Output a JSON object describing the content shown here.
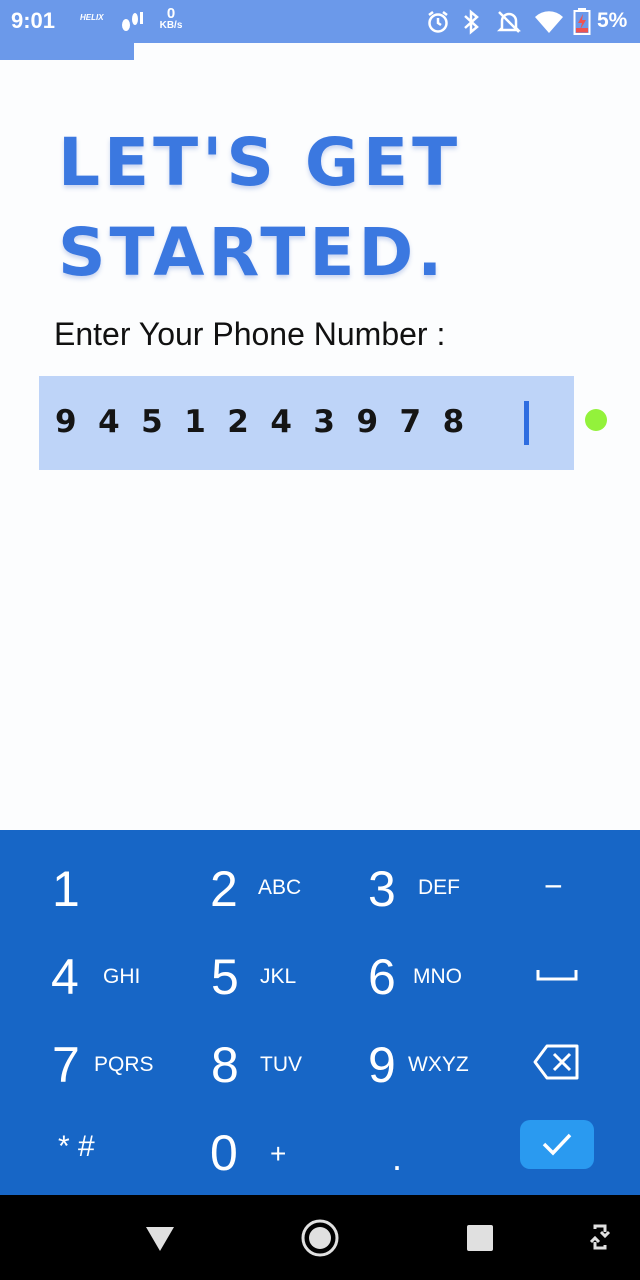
{
  "status_bar": {
    "time": "9:01",
    "carrier_logo": "HELIX",
    "network_speed_value": "0",
    "network_speed_unit": "KB/s",
    "battery_percent": "5%",
    "icons": [
      "notification-icon",
      "alarm-icon",
      "bluetooth-icon",
      "bell-off-icon",
      "wifi-icon",
      "battery-charging-icon"
    ]
  },
  "progress": {
    "value": 0.21
  },
  "heading": {
    "line1": "LET'S GET",
    "line2": "STARTED."
  },
  "prompt": "Enter Your Phone Number :",
  "phone_field": {
    "value": "9451243978"
  },
  "colors": {
    "accent": "#3b78e0",
    "status_bar": "#6b99ea",
    "field_bg": "#bed4f8",
    "keyboard_bg": "#1766c6",
    "valid_indicator": "#93f23b",
    "done_key": "#2a9af0"
  },
  "keyboard": {
    "rows": [
      [
        {
          "main": "1",
          "sub": ""
        },
        {
          "main": "2",
          "sub": "ABC"
        },
        {
          "main": "3",
          "sub": "DEF"
        },
        {
          "main": "−",
          "sub": ""
        }
      ],
      [
        {
          "main": "4",
          "sub": "GHI"
        },
        {
          "main": "5",
          "sub": "JKL"
        },
        {
          "main": "6",
          "sub": "MNO"
        },
        {
          "main": "space-icon",
          "sub": ""
        }
      ],
      [
        {
          "main": "7",
          "sub": "PQRS"
        },
        {
          "main": "8",
          "sub": "TUV"
        },
        {
          "main": "9",
          "sub": "WXYZ"
        },
        {
          "main": "backspace-icon",
          "sub": ""
        }
      ],
      [
        {
          "main": "* #",
          "sub": ""
        },
        {
          "main": "0",
          "sub": "+"
        },
        {
          "main": ".",
          "sub": ""
        },
        {
          "main": "check-icon",
          "sub": ""
        }
      ]
    ]
  },
  "nav_bar": {
    "icons": [
      "back-icon",
      "home-icon",
      "recents-icon",
      "rotate-icon"
    ]
  }
}
